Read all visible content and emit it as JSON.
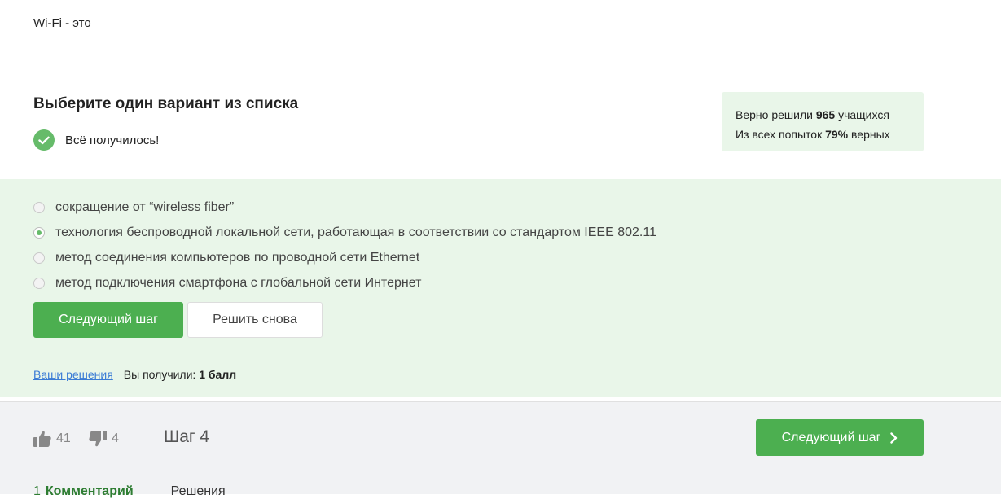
{
  "question": {
    "text": "Wi-Fi - это"
  },
  "prompt": {
    "title": "Выберите один вариант из списка",
    "status": "Всё получилось!"
  },
  "stats": {
    "line1_prefix": "Верно решили ",
    "solved_count": "965",
    "line1_suffix": " учащихся",
    "line2_prefix": "Из всех попыток ",
    "percent": "79%",
    "line2_suffix": " верных"
  },
  "options": [
    {
      "label": "сокращение от “wireless fiber”",
      "selected": false
    },
    {
      "label": "технология беспроводной локальной сети, работающая в соответствии со стандартом IEEE 802.11",
      "selected": true
    },
    {
      "label": "метод соединения компьютеров по проводной сети Ethernet",
      "selected": false
    },
    {
      "label": "метод подключения смартфона с глобальной сети Интернет",
      "selected": false
    }
  ],
  "buttons": {
    "next_step": "Следующий шаг",
    "retry": "Решить снова"
  },
  "result": {
    "link": "Ваши решения",
    "prefix": "Вы получили: ",
    "score": "1 балл"
  },
  "footer": {
    "likes": "41",
    "dislikes": "4",
    "step": "Шаг 4",
    "next_button": "Следующий шаг",
    "tabs": {
      "comments_count": "1",
      "comments": "Комментарий",
      "solutions": "Решения"
    }
  },
  "colors": {
    "accent": "#4caf50",
    "panel_bg": "#e9f6e9",
    "link": "#3a7bd5",
    "footer_bg": "#f1f2f4"
  },
  "icons": [
    "check-circle-icon",
    "thumbs-up-icon",
    "thumbs-down-icon",
    "chevron-right-icon"
  ]
}
